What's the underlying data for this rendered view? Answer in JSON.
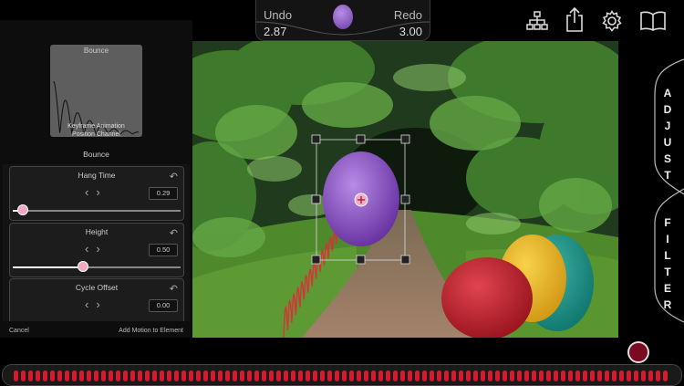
{
  "toolbar": {
    "undo_label": "Undo",
    "undo_value": "2.87",
    "redo_label": "Redo",
    "redo_value": "3.00",
    "icons": [
      "hierarchy-icon",
      "share-icon",
      "gear-icon",
      "book-icon"
    ]
  },
  "left_panel": {
    "preview_title": "Bounce",
    "caption_line1": "Keyframe Animation",
    "caption_line2": "Position Channel",
    "section_title": "Bounce",
    "params": [
      {
        "label": "Hang Time",
        "value": "0.29",
        "slider_fraction": 0.06
      },
      {
        "label": "Height",
        "value": "0.50",
        "slider_fraction": 0.42
      },
      {
        "label": "Cycle Offset",
        "value": "0.00"
      }
    ],
    "cancel_label": "Cancel",
    "add_motion_label": "Add Motion to Element"
  },
  "right_panel": {
    "adjust_label": "ADJUST",
    "filter_label": "FILTER"
  },
  "colors": {
    "accent": "#f0a8c4",
    "egg_purple": "#8a4fc0",
    "record": "#7a0a22",
    "timeline_dot": "#d81b2c"
  }
}
